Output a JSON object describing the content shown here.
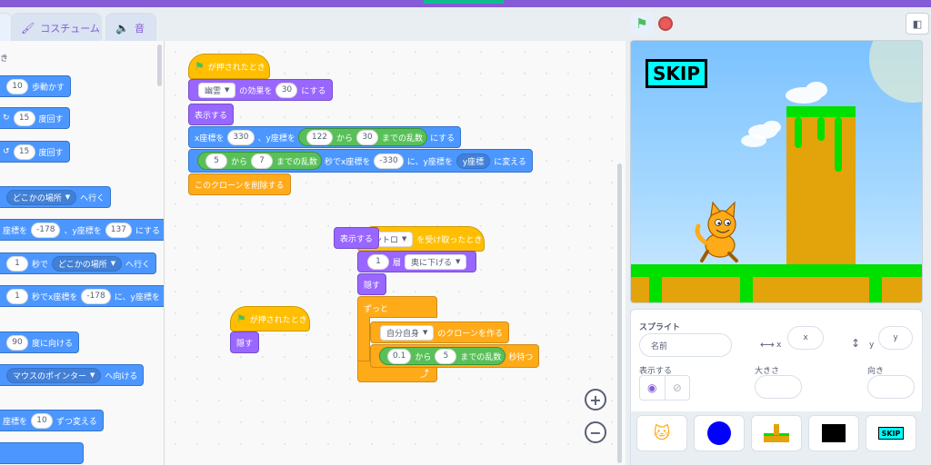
{
  "tabs": [
    {
      "label": "",
      "icon": "code-icon"
    },
    {
      "label": "コスチューム",
      "icon": "brush-icon"
    },
    {
      "label": "音",
      "icon": "speaker-icon"
    }
  ],
  "palette": {
    "category_label": "き",
    "blocks": [
      {
        "before": "",
        "value": "10",
        "after": "歩動かす"
      },
      {
        "before": "",
        "value": "15",
        "after": "度回す"
      },
      {
        "before": "",
        "value": "15",
        "after": "度回す"
      },
      {
        "dropdown": "どこかの場所",
        "after": "へ行く"
      },
      {
        "before": "座標を",
        "value": "-178",
        "mid": "、y座標を",
        "value2": "137",
        "after": "にする"
      },
      {
        "value": "1",
        "mid": "秒で",
        "dropdown": "どこかの場所",
        "after": "へ行く"
      },
      {
        "value": "1",
        "mid": "秒でx座標を",
        "value2": "-178",
        "after": "に、y座標を"
      },
      {
        "value": "90",
        "after": "度に向ける"
      },
      {
        "dropdown": "マウスのポインター",
        "after": "へ向ける"
      },
      {
        "before": "座標を",
        "value": "10",
        "after": "ずつ変える"
      }
    ]
  },
  "script1": {
    "hat": "が押されたとき",
    "effect_dropdown": "幽霊",
    "effect_mid": "の効果を",
    "effect_value": "30",
    "effect_after": "にする",
    "show": "表示する",
    "goto_x_label": "x座標を",
    "goto_x_value": "330",
    "goto_y_label": "、y座標を",
    "rand_from": "122",
    "rand_from_label": "から",
    "rand_to": "30",
    "rand_to_label": "までの乱数",
    "goto_after": "にする",
    "glide_from": "5",
    "glide_from_label": "から",
    "glide_to": "7",
    "glide_rand_label": "までの乱数",
    "glide_mid": "秒でx座標を",
    "glide_x": "-330",
    "glide_y_label": "に、y座標を",
    "glide_y_reporter": "y座標",
    "glide_after": "に変える",
    "delete_clone": "このクローンを削除する"
  },
  "script2": {
    "hat_dropdown": "ントロ",
    "hat_after": "を受け取ったとき",
    "floating_show": "表示する",
    "layer_value": "1",
    "layer_mid": "層",
    "layer_dropdown": "奥に下げる",
    "hide": "隠す",
    "forever": "ずっと",
    "clone_dropdown": "自分自身",
    "clone_after": "のクローンを作る",
    "wait_from": "0.1",
    "wait_from_label": "から",
    "wait_to": "5",
    "wait_rand_label": "までの乱数",
    "wait_after": "秒待つ",
    "loop_arrow": "⤴"
  },
  "script3": {
    "hat": "が押されたとき",
    "hide": "隠す"
  },
  "zoom": {
    "in": "+",
    "out": "−"
  },
  "stage": {
    "skip_label": "SKIP"
  },
  "sprite_panel": {
    "sprite_label": "スプライト",
    "name_placeholder": "名前",
    "x_label": "x",
    "x_placeholder": "x",
    "y_label": "y",
    "y_placeholder": "y",
    "show_label": "表示する",
    "size_label": "大きさ",
    "direction_label": "向き",
    "thumbs": [
      {
        "name": "cat",
        "icon": "cat-icon"
      },
      {
        "name": "circle",
        "icon": "blue-circle-icon"
      },
      {
        "name": "platform",
        "icon": "platform-icon"
      },
      {
        "name": "dark",
        "icon": "black-screen-icon"
      },
      {
        "name": "skip",
        "label": "SKIP"
      }
    ]
  },
  "colors": {
    "motion": "#4c97ff",
    "looks": "#9966ff",
    "events": "#ffbf00",
    "control": "#ffab19",
    "operators": "#59c059",
    "accent": "#855cd6"
  }
}
